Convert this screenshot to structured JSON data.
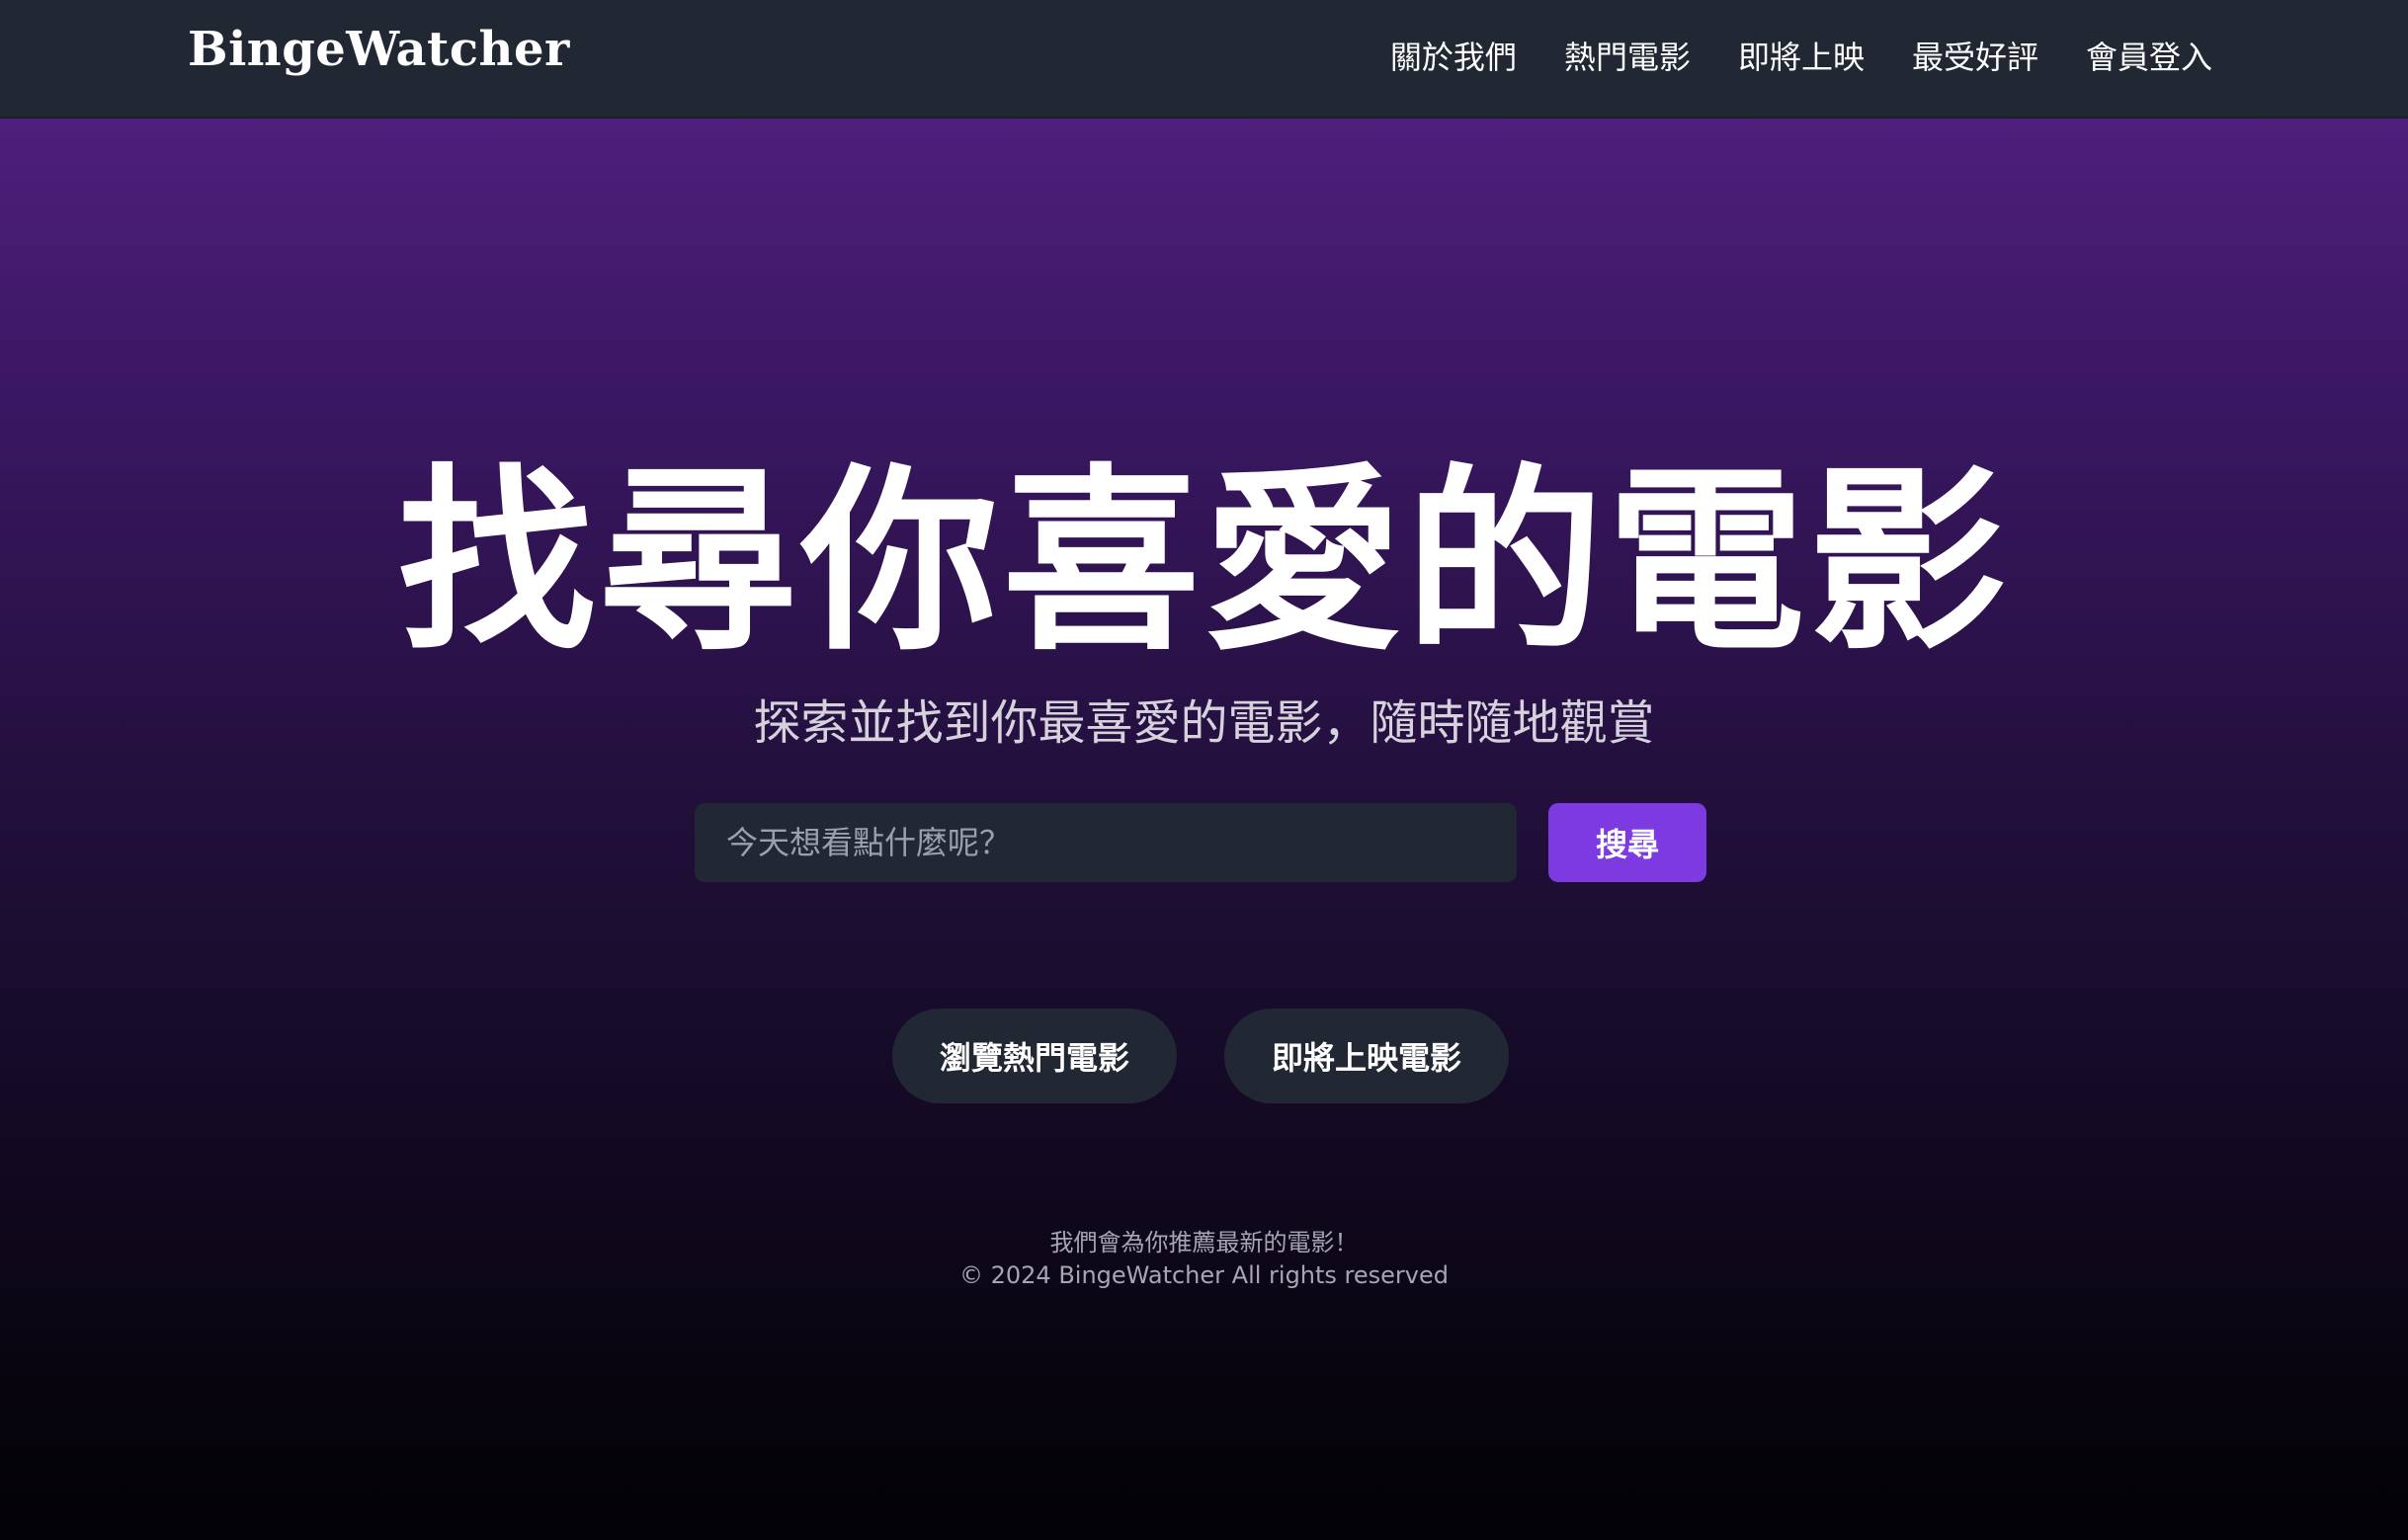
{
  "navbar": {
    "brand": "BingeWatcher",
    "links": [
      "關於我們",
      "熱門電影",
      "即將上映",
      "最受好評",
      "會員登入"
    ]
  },
  "hero": {
    "title": "找尋你喜愛的電影",
    "subtitle": "探索並找到你最喜愛的電影，隨時隨地觀賞"
  },
  "search": {
    "placeholder": "今天想看點什麼呢？",
    "value": "",
    "button_label": "搜尋"
  },
  "actions": {
    "browse_popular": "瀏覽熱門電影",
    "upcoming": "即將上映電影"
  },
  "footer": {
    "tagline": "我們會為你推薦最新的電影！",
    "copyright": "© 2024 BingeWatcher All rights reserved"
  },
  "colors": {
    "navbar_bg": "#212833",
    "accent": "#7c3ae0",
    "gradient_top": "#4e1f7c",
    "gradient_bottom": "#030206"
  }
}
